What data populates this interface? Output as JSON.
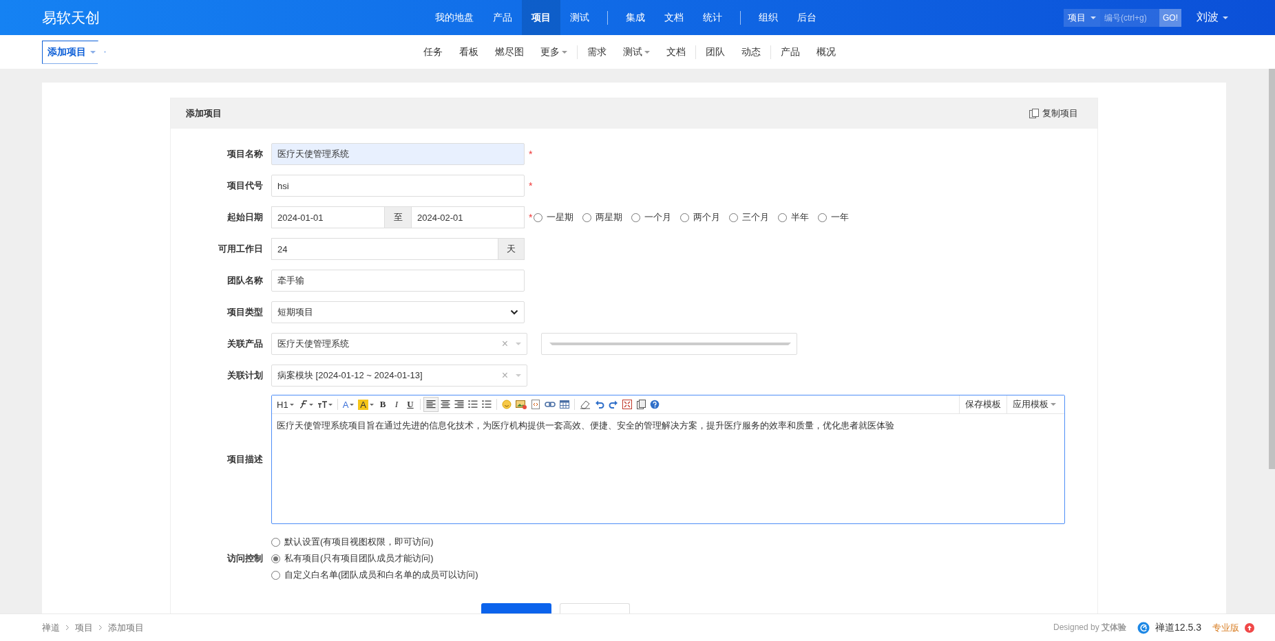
{
  "topbar": {
    "logo": "易软天创",
    "nav_groups": [
      [
        {
          "label": "我的地盘",
          "selected": false
        },
        {
          "label": "产品",
          "selected": false
        },
        {
          "label": "项目",
          "selected": true
        },
        {
          "label": "测试",
          "selected": false
        }
      ],
      [
        {
          "label": "集成",
          "selected": false
        },
        {
          "label": "文档",
          "selected": false
        },
        {
          "label": "统计",
          "selected": false
        }
      ],
      [
        {
          "label": "组织",
          "selected": false
        },
        {
          "label": "后台",
          "selected": false
        }
      ]
    ],
    "search": {
      "type": "项目",
      "placeholder": "编号(ctrl+g)",
      "button": "GO!"
    },
    "user": "刘波"
  },
  "subnav": {
    "current": "添加项目",
    "groups": [
      [
        {
          "label": "任务",
          "dropdown": false
        },
        {
          "label": "看板",
          "dropdown": false
        },
        {
          "label": "燃尽图",
          "dropdown": false
        },
        {
          "label": "更多",
          "dropdown": true
        }
      ],
      [
        {
          "label": "需求",
          "dropdown": false
        },
        {
          "label": "测试",
          "dropdown": true
        },
        {
          "label": "文档",
          "dropdown": false
        }
      ],
      [
        {
          "label": "团队",
          "dropdown": false
        },
        {
          "label": "动态",
          "dropdown": false
        }
      ],
      [
        {
          "label": "产品",
          "dropdown": false
        },
        {
          "label": "概况",
          "dropdown": false
        }
      ]
    ]
  },
  "panel": {
    "title": "添加项目",
    "copy_button": "复制项目"
  },
  "fields": [
    {
      "kind": "text",
      "label": "项目名称",
      "value": "医疗天使管理系统",
      "required_mark": "*",
      "highlighted": true
    },
    {
      "kind": "text",
      "label": "项目代号",
      "value": "hsi",
      "required_mark": "*",
      "highlighted": false
    },
    {
      "kind": "daterange",
      "label": "起始日期",
      "begin": "2024-01-01",
      "separator": "至",
      "end": "2024-02-01",
      "required_mark": "*",
      "options": [
        {
          "label": "一星期",
          "selected": false
        },
        {
          "label": "两星期",
          "selected": false
        },
        {
          "label": "一个月",
          "selected": false
        },
        {
          "label": "两个月",
          "selected": false
        },
        {
          "label": "三个月",
          "selected": false
        },
        {
          "label": "半年",
          "selected": false
        },
        {
          "label": "一年",
          "selected": false
        }
      ]
    },
    {
      "kind": "days",
      "label": "可用工作日",
      "value": "24",
      "unit": "天"
    },
    {
      "kind": "text",
      "label": "团队名称",
      "value": "牵手输",
      "highlighted": false
    },
    {
      "kind": "select",
      "label": "项目类型",
      "value": "短期项目"
    },
    {
      "kind": "chosen",
      "label": "关联产品",
      "value": "医疗天使管理系统",
      "clear": "×",
      "extra_select": true
    },
    {
      "kind": "chosen",
      "label": "关联计划",
      "value": "病案模块 [2024-01-12 ~ 2024-01-13]",
      "clear": "×",
      "extra_select": false
    },
    {
      "kind": "editor",
      "label": "项目描述",
      "value": "医疗天使管理系统项目旨在通过先进的信息化技术，为医疗机构提供一套高效、便捷、安全的管理解决方案，提升医疗服务的效率和质量，优化患者就医体验",
      "toolbar": [
        {
          "kind": "text",
          "label": "H1",
          "dropdown": true
        },
        {
          "kind": "font",
          "dropdown": true
        },
        {
          "kind": "size",
          "dropdown": true
        },
        {
          "kind": "sep"
        },
        {
          "kind": "color",
          "label": "A",
          "dropdown": true
        },
        {
          "kind": "highlight",
          "label": "A",
          "dropdown": true
        },
        {
          "kind": "bold",
          "label": "B"
        },
        {
          "kind": "italic",
          "label": "I"
        },
        {
          "kind": "underline",
          "label": "U"
        },
        {
          "kind": "sep"
        },
        {
          "kind": "align-left",
          "selected": true
        },
        {
          "kind": "align-center",
          "selected": false
        },
        {
          "kind": "align-right",
          "selected": false
        },
        {
          "kind": "ordered-list"
        },
        {
          "kind": "bullet-list"
        },
        {
          "kind": "sep"
        },
        {
          "kind": "emoji"
        },
        {
          "kind": "image"
        },
        {
          "kind": "code"
        },
        {
          "kind": "link"
        },
        {
          "kind": "table"
        },
        {
          "kind": "sep"
        },
        {
          "kind": "eraser"
        },
        {
          "kind": "undo"
        },
        {
          "kind": "redo"
        },
        {
          "kind": "fullscreen"
        },
        {
          "kind": "paste"
        },
        {
          "kind": "help"
        }
      ],
      "template_buttons": [
        {
          "label": "保存模板",
          "dropdown": false
        },
        {
          "label": "应用模板",
          "dropdown": true
        }
      ]
    },
    {
      "kind": "radios",
      "label": "访问控制",
      "options": [
        {
          "label": "默认设置(有项目视图权限，即可访问)",
          "selected": false
        },
        {
          "label": "私有项目(只有项目团队成员才能访问)",
          "selected": true
        },
        {
          "label": "自定义白名单(团队成员和白名单的成员可以访问)",
          "selected": false
        }
      ]
    }
  ],
  "actions": [
    {
      "primary": true
    },
    {
      "primary": false
    }
  ],
  "footer": {
    "breadcrumb": [
      "禅道",
      "项目",
      "添加项目"
    ],
    "designed_by": "Designed by **艾体验**",
    "version": "禅道12.5.3",
    "edition": "专业版"
  }
}
